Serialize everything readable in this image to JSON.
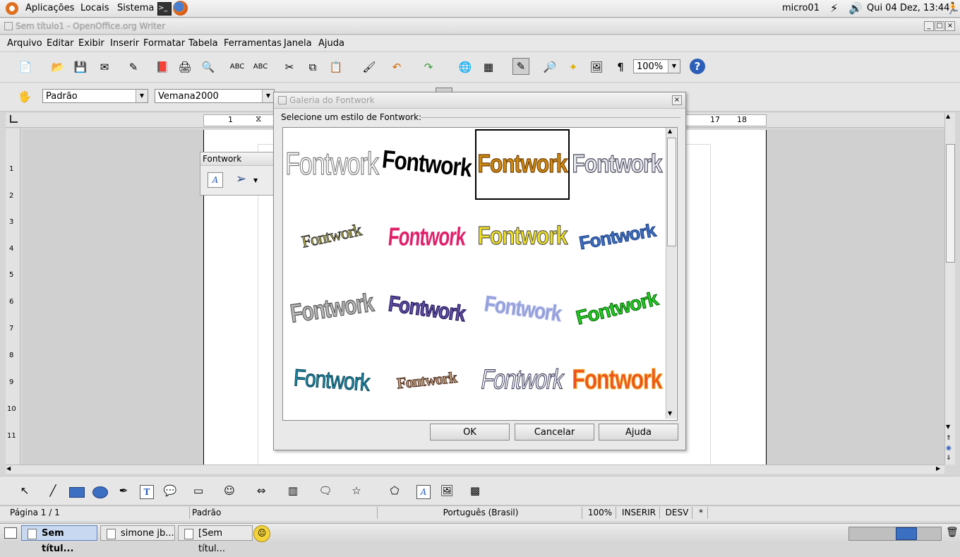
{
  "top_panel": {
    "menus": [
      "Aplicações",
      "Locais",
      "Sistema"
    ],
    "user": "micro01",
    "datetime": "Qui 04 Dez, 13:44"
  },
  "window": {
    "title": "Sem título1 - OpenOffice.org Writer"
  },
  "menubar": [
    "Arquivo",
    "Editar",
    "Exibir",
    "Inserir",
    "Formatar",
    "Tabela",
    "Ferramentas",
    "Janela",
    "Ajuda"
  ],
  "toolbar": {
    "zoom": "100%"
  },
  "format_toolbar": {
    "style": "Padrão",
    "font": "Vemana2000"
  },
  "ruler": {
    "top_numbers": [
      "1",
      "17",
      "18"
    ],
    "left_numbers": [
      "1",
      "2",
      "3",
      "4",
      "5",
      "6",
      "7",
      "8",
      "9",
      "10",
      "11"
    ]
  },
  "fontwork_toolbar": {
    "title": "Fontwork"
  },
  "dialog": {
    "title": "Galeria do Fontwork",
    "prompt": "Selecione um estilo de Fontwork:",
    "item_text": "Fontwork",
    "ok": "OK",
    "cancel": "Cancelar",
    "help": "Ajuda"
  },
  "statusbar": {
    "page": "Página 1 / 1",
    "style": "Padrão",
    "language": "Português (Brasil)",
    "zoom": "100%",
    "insert": "INSERIR",
    "selection": "DESV",
    "modified": "*"
  },
  "taskbar": {
    "tasks": [
      "Sem títul...",
      "simone jb...",
      "[Sem títul..."
    ]
  },
  "colors": {
    "selection_blue": "#3b6fc2",
    "panel_bg": "#e4e4e4"
  }
}
